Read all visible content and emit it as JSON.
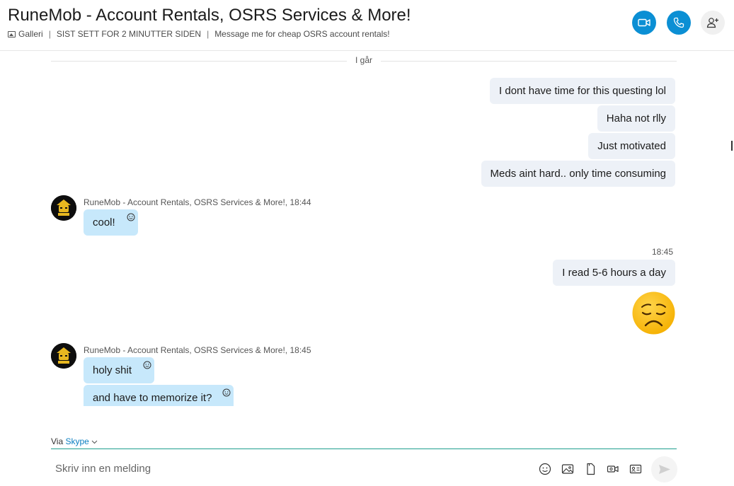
{
  "header": {
    "title": "RuneMob - Account Rentals, OSRS Services & More!",
    "gallery_label": "Galleri",
    "last_seen": "SIST SETT FOR 2 MINUTTER SIDEN",
    "mood": "Message me for cheap OSRS account rentals!"
  },
  "day_separator": "I går",
  "messages": {
    "out1": [
      "I dont have time for this questing lol",
      "Haha not rlly",
      "Just motivated",
      "Meds aint hard.. only time consuming"
    ],
    "in1": {
      "sender": "RuneMob - Account Rentals, OSRS Services & More!,",
      "time": "18:44",
      "texts": [
        "cool!"
      ]
    },
    "out2": {
      "time": "18:45",
      "texts": [
        "I read 5-6 hours a day"
      ],
      "emoji": "pensive-face"
    },
    "in2": {
      "sender": "RuneMob - Account Rentals, OSRS Services & More!,",
      "time": "18:45",
      "texts": [
        "holy shit",
        "and have to memorize it?"
      ]
    }
  },
  "composer": {
    "via_label": "Via",
    "via_link": "Skype",
    "placeholder": "Skriv inn en melding"
  },
  "colors": {
    "accent": "#0b8fd4",
    "outgoing_bubble": "#edf1f7",
    "incoming_bubble": "#c7e8fb",
    "composer_line": "#1e9e8e"
  }
}
